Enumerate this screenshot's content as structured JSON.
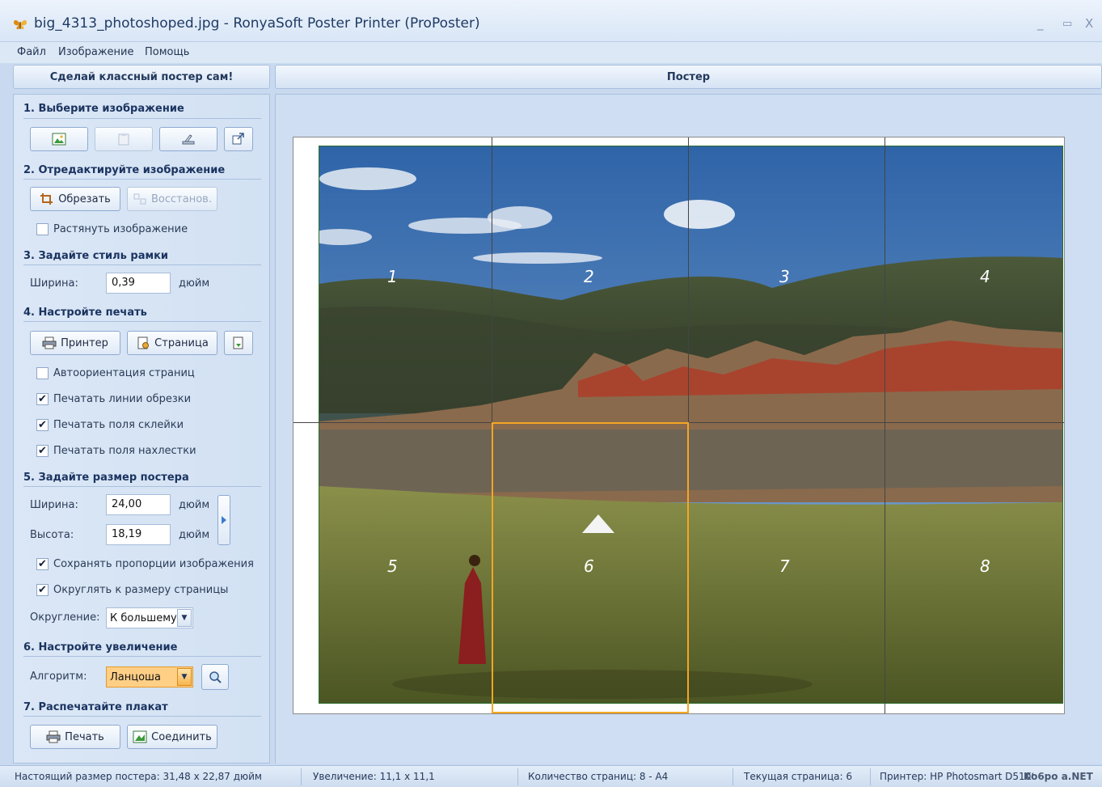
{
  "window": {
    "title": "big_4313_photoshoped.jpg - RonyaSoft Poster Printer (ProPoster)",
    "minimize": "_",
    "maximize": "▭",
    "close": "X"
  },
  "menu": [
    "Файл",
    "Изображение",
    "Помощь"
  ],
  "left_panel": {
    "header": "Сделай классный постер сам!",
    "section1": {
      "title": "1. Выберите изображение"
    },
    "section2": {
      "title": "2. Отредактируйте изображение",
      "crop_label": "Обрезать",
      "restore_label": "Восстанов.",
      "stretch_label": "Растянуть изображение",
      "stretch_checked": false
    },
    "section3": {
      "title": "3. Задайте стиль рамки",
      "width_label": "Ширина:",
      "width_value": "0,39",
      "unit": "дюйм"
    },
    "section4": {
      "title": "4. Настройте печать",
      "printer_label": "Принтер",
      "page_label": "Страница",
      "checks": [
        {
          "label": "Автоориентация страниц",
          "checked": false
        },
        {
          "label": "Печатать линии обрезки",
          "checked": true
        },
        {
          "label": "Печатать поля склейки",
          "checked": true
        },
        {
          "label": "Печатать поля нахлестки",
          "checked": true
        }
      ]
    },
    "section5": {
      "title": "5. Задайте размер постера",
      "width_label": "Ширина:",
      "width_value": "24,00",
      "height_label": "Высота:",
      "height_value": "18,19",
      "unit": "дюйм",
      "keep_proportions_label": "Сохранять пропорции изображения",
      "keep_proportions_checked": true,
      "round_to_page_label": "Округлять к размеру страницы",
      "round_to_page_checked": true,
      "rounding_label": "Округление:",
      "rounding_value": "К большему"
    },
    "section6": {
      "title": "6. Настройте увеличение",
      "algorithm_label": "Алгоритм:",
      "algorithm_value": "Ланцоша"
    },
    "section7": {
      "title": "7. Распечатайте плакат",
      "print_label": "Печать",
      "join_label": "Соединить"
    }
  },
  "poster": {
    "header": "Постер",
    "page_numbers": [
      "1",
      "2",
      "3",
      "4",
      "5",
      "6",
      "7",
      "8"
    ],
    "current_page": 6
  },
  "status": {
    "size": "Настоящий размер постера: 31,48 x 22,87 дюйм",
    "zoom": "Увеличение: 11,1 x 11,1",
    "pages": "Количество страниц: 8 - A4",
    "current": "Текущая страница: 6",
    "printer": "Принтер: HP Photosmart D5100 series",
    "watermark": "Ko6po a.NET"
  },
  "colors": {
    "accent": "#f5a623",
    "panel": "#d6e4f5",
    "frame": "#2c6e2c"
  }
}
